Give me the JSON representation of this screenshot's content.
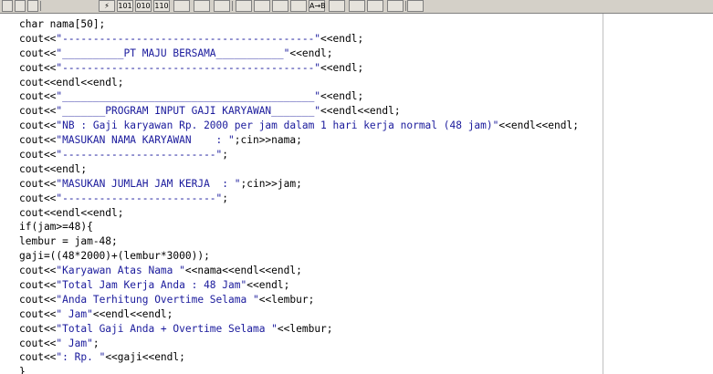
{
  "toolbar": {
    "buttons": [
      {
        "icon": "window-icon"
      },
      {
        "icon": "window-icon"
      },
      {
        "icon": "window-icon"
      },
      {
        "icon": "lightning-icon",
        "label": "⚡"
      },
      {
        "icon": "binary-101-icon",
        "label": "101"
      },
      {
        "icon": "binary-010-icon",
        "label": "010"
      },
      {
        "icon": "binary-110-icon",
        "label": "110"
      },
      {
        "icon": "reset-icon"
      },
      {
        "icon": "run-icon"
      },
      {
        "icon": "refresh-icon"
      },
      {
        "icon": "check-icon"
      },
      {
        "icon": "tool-icon"
      },
      {
        "icon": "compile-icon"
      },
      {
        "icon": "folder-icon"
      },
      {
        "icon": "replace-icon",
        "label": "A→B"
      },
      {
        "icon": "dots-icon"
      },
      {
        "icon": "tree-icon"
      },
      {
        "icon": "panel-icon"
      },
      {
        "icon": "split-icon"
      },
      {
        "icon": "pointer-icon"
      }
    ]
  },
  "editor": {
    "lines": [
      [
        {
          "t": "char nama[50];",
          "c": "kw"
        }
      ],
      [
        {
          "t": "cout<<",
          "c": "kw"
        },
        {
          "t": "\"-----------------------------------------\"",
          "c": "str"
        },
        {
          "t": "<<endl;",
          "c": "kw"
        }
      ],
      [
        {
          "t": "cout<<",
          "c": "kw"
        },
        {
          "t": "\"__________PT MAJU BERSAMA___________\"",
          "c": "str"
        },
        {
          "t": "<<endl;",
          "c": "kw"
        }
      ],
      [
        {
          "t": "cout<<",
          "c": "kw"
        },
        {
          "t": "\"-----------------------------------------\"",
          "c": "str"
        },
        {
          "t": "<<endl;",
          "c": "kw"
        }
      ],
      [
        {
          "t": "cout<<endl<<endl;",
          "c": "kw"
        }
      ],
      [
        {
          "t": "cout<<",
          "c": "kw"
        },
        {
          "t": "\"_________________________________________\"",
          "c": "str"
        },
        {
          "t": "<<endl;",
          "c": "kw"
        }
      ],
      [
        {
          "t": "cout<<",
          "c": "kw"
        },
        {
          "t": "\"_______PROGRAM INPUT GAJI KARYAWAN_______\"",
          "c": "str"
        },
        {
          "t": "<<endl<<endl;",
          "c": "kw"
        }
      ],
      [
        {
          "t": "cout<<",
          "c": "kw"
        },
        {
          "t": "\"NB : Gaji karyawan Rp. 2000 per jam dalam 1 hari kerja normal (48 jam)\"",
          "c": "str"
        },
        {
          "t": "<<endl<<endl;",
          "c": "kw"
        }
      ],
      [
        {
          "t": "cout<<",
          "c": "kw"
        },
        {
          "t": "\"MASUKAN NAMA KARYAWAN    : \"",
          "c": "str"
        },
        {
          "t": ";cin>>nama;",
          "c": "kw"
        }
      ],
      [
        {
          "t": "cout<<",
          "c": "kw"
        },
        {
          "t": "\"-------------------------\"",
          "c": "str"
        },
        {
          "t": ";",
          "c": "kw"
        }
      ],
      [
        {
          "t": "cout<<endl;",
          "c": "kw"
        }
      ],
      [
        {
          "t": "cout<<",
          "c": "kw"
        },
        {
          "t": "\"MASUKAN JUMLAH JAM KERJA  : \"",
          "c": "str"
        },
        {
          "t": ";cin>>jam;",
          "c": "kw"
        }
      ],
      [
        {
          "t": "cout<<",
          "c": "kw"
        },
        {
          "t": "\"-------------------------\"",
          "c": "str"
        },
        {
          "t": ";",
          "c": "kw"
        }
      ],
      [
        {
          "t": "cout<<endl<<endl;",
          "c": "kw"
        }
      ],
      [
        {
          "t": "if(jam>=48){",
          "c": "kw"
        }
      ],
      [
        {
          "t": "lembur = jam-48;",
          "c": "kw"
        }
      ],
      [
        {
          "t": "gaji=((48*2000)+(lembur*3000));",
          "c": "kw"
        }
      ],
      [
        {
          "t": "cout<<",
          "c": "kw"
        },
        {
          "t": "\"Karyawan Atas Nama \"",
          "c": "str"
        },
        {
          "t": "<<nama<<endl<<endl;",
          "c": "kw"
        }
      ],
      [
        {
          "t": "cout<<",
          "c": "kw"
        },
        {
          "t": "\"Total Jam Kerja Anda : 48 Jam\"",
          "c": "str"
        },
        {
          "t": "<<endl;",
          "c": "kw"
        }
      ],
      [
        {
          "t": "cout<<",
          "c": "kw"
        },
        {
          "t": "\"Anda Terhitung Overtime Selama \"",
          "c": "str"
        },
        {
          "t": "<<lembur;",
          "c": "kw"
        }
      ],
      [
        {
          "t": "cout<<",
          "c": "kw"
        },
        {
          "t": "\" Jam\"",
          "c": "str"
        },
        {
          "t": "<<endl<<endl;",
          "c": "kw"
        }
      ],
      [
        {
          "t": "cout<<",
          "c": "kw"
        },
        {
          "t": "\"Total Gaji Anda + Overtime Selama \"",
          "c": "str"
        },
        {
          "t": "<<lembur;",
          "c": "kw"
        }
      ],
      [
        {
          "t": "cout<<",
          "c": "kw"
        },
        {
          "t": "\" Jam\"",
          "c": "str"
        },
        {
          "t": ";",
          "c": "kw"
        }
      ],
      [
        {
          "t": "cout<<",
          "c": "kw"
        },
        {
          "t": "\": Rp. \"",
          "c": "str"
        },
        {
          "t": "<<gaji<<endl;",
          "c": "kw"
        }
      ],
      [
        {
          "t": "}",
          "c": "kw"
        }
      ]
    ]
  },
  "colors": {
    "string": "#1a1a9c",
    "code": "#000000",
    "toolbar_bg": "#d4d0c8"
  }
}
